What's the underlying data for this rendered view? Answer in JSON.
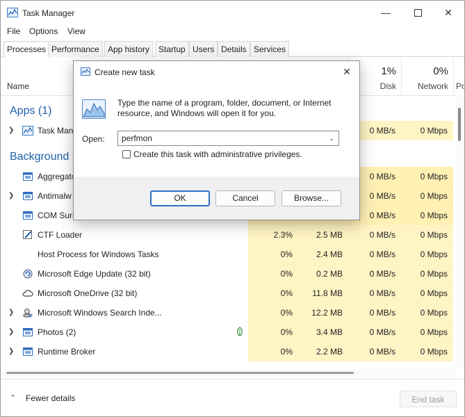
{
  "window": {
    "title": "Task Manager"
  },
  "menu": [
    "File",
    "Options",
    "View"
  ],
  "tabs": [
    "Processes",
    "Performance",
    "App history",
    "Startup",
    "Users",
    "Details",
    "Services"
  ],
  "columns": {
    "name": "Name",
    "disk": {
      "pct": "1%",
      "label": "Disk"
    },
    "network": {
      "pct": "0%",
      "label": "Network"
    },
    "power": {
      "label": "Po"
    }
  },
  "groups": {
    "apps": "Apps (1)",
    "background": "Background p"
  },
  "app_row": {
    "name": "Task Mana",
    "disk": "0 MB/s",
    "net": "0 Mbps"
  },
  "rows": [
    {
      "name": "Aggregato",
      "cpu": "",
      "mem": "",
      "disk": "0 MB/s",
      "net": "0 Mbps",
      "icon": "window-icon",
      "expand": false
    },
    {
      "name": "Antimalw",
      "cpu": "",
      "mem": "",
      "disk": "0 MB/s",
      "net": "0 Mbps",
      "icon": "window-icon",
      "expand": true
    },
    {
      "name": "COM Surr",
      "cpu": "",
      "mem": "",
      "disk": "0 MB/s",
      "net": "0 Mbps",
      "icon": "window-icon",
      "expand": false
    },
    {
      "name": "CTF Loader",
      "cpu": "2.3%",
      "mem": "2.5 MB",
      "disk": "0 MB/s",
      "net": "0 Mbps",
      "icon": "pen-icon",
      "expand": false
    },
    {
      "name": "Host Process for Windows Tasks",
      "cpu": "0%",
      "mem": "2.4 MB",
      "disk": "0 MB/s",
      "net": "0 Mbps",
      "icon": "none",
      "expand": false
    },
    {
      "name": "Microsoft Edge Update (32 bit)",
      "cpu": "0%",
      "mem": "0.2 MB",
      "disk": "0 MB/s",
      "net": "0 Mbps",
      "icon": "update-icon",
      "expand": false
    },
    {
      "name": "Microsoft OneDrive (32 bit)",
      "cpu": "0%",
      "mem": "11.8 MB",
      "disk": "0 MB/s",
      "net": "0 Mbps",
      "icon": "cloud-icon",
      "expand": false
    },
    {
      "name": "Microsoft Windows Search Inde...",
      "cpu": "0%",
      "mem": "12.2 MB",
      "disk": "0 MB/s",
      "net": "0 Mbps",
      "icon": "search-user-icon",
      "expand": true
    },
    {
      "name": "Photos (2)",
      "cpu": "0%",
      "mem": "3.4 MB",
      "disk": "0 MB/s",
      "net": "0 Mbps",
      "icon": "window-icon",
      "expand": true,
      "leaf": true
    },
    {
      "name": "Runtime Broker",
      "cpu": "0%",
      "mem": "2.2 MB",
      "disk": "0 MB/s",
      "net": "0 Mbps",
      "icon": "window-icon",
      "expand": true
    }
  ],
  "footer": {
    "fewer_details": "Fewer details",
    "end_task": "End task"
  },
  "dialog": {
    "title": "Create new task",
    "message": "Type the name of a program, folder, document, or Internet resource, and Windows will open it for you.",
    "open_label": "Open:",
    "open_value": "perfmon",
    "checkbox_label": "Create this task with administrative privileges.",
    "ok": "OK",
    "cancel": "Cancel",
    "browse": "Browse..."
  }
}
